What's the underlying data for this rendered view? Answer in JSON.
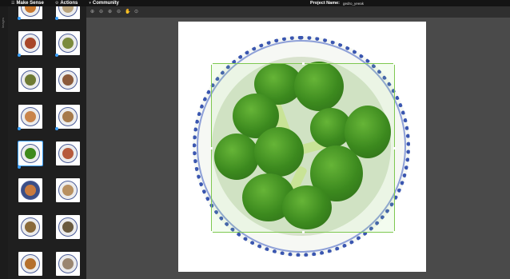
{
  "topbar": {
    "app_name": "Make Sense",
    "actions_label": "Actions",
    "community_label": "Community",
    "project_label": "Project Name:",
    "project_name": "gedro_yeeak"
  },
  "left_tab": {
    "label": "Images"
  },
  "toolbar": {
    "tools": [
      "zoom-in-icon",
      "zoom-out-icon",
      "zoom-fit-icon",
      "zoom-max-icon",
      "hand-icon",
      "crosshair-icon"
    ]
  },
  "colors": {
    "accent": "#39a0ff",
    "bbox": "#7ec850",
    "topbar": "#141414",
    "sidebar": "#1f1f1f",
    "workspace": "#4a4a4a"
  }
}
